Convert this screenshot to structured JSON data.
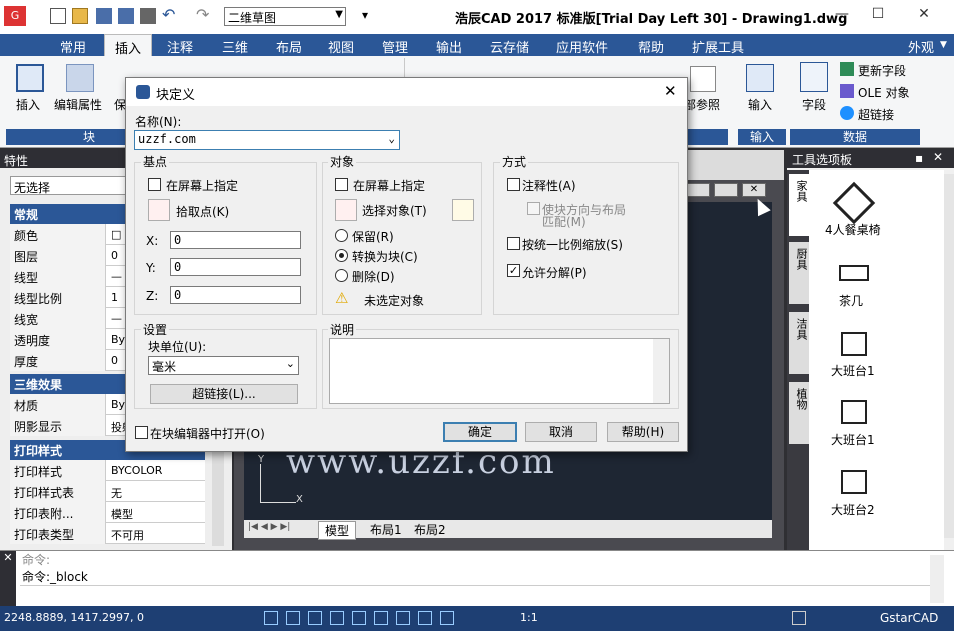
{
  "titlebar": {
    "title": "浩辰CAD 2017 标准版[Trial Day Left 30] - Drawing1.dwg",
    "workspace": "二维草图",
    "colors": {
      "accent": "#2b5797"
    }
  },
  "menu": {
    "tabs": [
      "常用",
      "插入",
      "注释",
      "三维",
      "布局",
      "视图",
      "管理",
      "输出",
      "云存储",
      "应用软件",
      "帮助",
      "扩展工具"
    ],
    "right": "外观"
  },
  "ribbon": {
    "insert_label": "插入",
    "edit_attr_label": "编辑属性",
    "bao_label": "保",
    "group_block": "块",
    "xref_label": "外部参照",
    "input_label": "输入",
    "group_input": "输入",
    "field_label": "字段",
    "update_field": "更新字段",
    "ole_object": "OLE 对象",
    "hyperlink": "超链接",
    "group_data": "数据"
  },
  "left_panel": {
    "title": "特性",
    "selection": "无选择",
    "sections": {
      "general": "常规",
      "three_d": "三维效果",
      "print": "打印样式"
    },
    "general_rows": [
      {
        "k": "颜色",
        "v": "□"
      },
      {
        "k": "图层",
        "v": "0"
      },
      {
        "k": "线型",
        "v": "—"
      },
      {
        "k": "线型比例",
        "v": "1"
      },
      {
        "k": "线宽",
        "v": "—"
      },
      {
        "k": "透明度",
        "v": "ByL"
      },
      {
        "k": "厚度",
        "v": "0"
      }
    ],
    "three_d_rows": [
      {
        "k": "材质",
        "v": "ByL"
      },
      {
        "k": "阴影显示",
        "v": "投射"
      }
    ],
    "print_rows": [
      {
        "k": "打印样式",
        "v": "BYCOLOR"
      },
      {
        "k": "打印样式表",
        "v": "无"
      },
      {
        "k": "打印表附...",
        "v": "模型"
      },
      {
        "k": "打印表类型",
        "v": "不可用"
      }
    ]
  },
  "drawing": {
    "watermark": "www.uzzf.com",
    "tabs": [
      "模型",
      "布局1",
      "布局2"
    ],
    "axis_y": "Y",
    "axis_x": "X"
  },
  "tool_palette": {
    "title": "工具选项板",
    "side_tabs": [
      "家具",
      "厨具",
      "洁具",
      "植物"
    ],
    "items": [
      "4人餐桌椅",
      "茶几",
      "大班台1",
      "大班台1",
      "大班台2"
    ]
  },
  "command": {
    "line1": "命令:",
    "line2": "命令:_block"
  },
  "status": {
    "coords": "2248.8889, 1417.2997, 0",
    "scale": "1:1",
    "brand": "GstarCAD"
  },
  "dialog": {
    "title": "块定义",
    "name_label": "名称(N):",
    "name_value": "uzzf.com",
    "base_point": {
      "title": "基点",
      "on_screen": "在屏幕上指定",
      "pick_point": "拾取点(K)",
      "x_label": "X:",
      "x_value": "0",
      "y_label": "Y:",
      "y_value": "0",
      "z_label": "Z:",
      "z_value": "0"
    },
    "objects": {
      "title": "对象",
      "on_screen": "在屏幕上指定",
      "select_objects": "选择对象(T)",
      "retain": "保留(R)",
      "convert": "转换为块(C)",
      "delete": "删除(D)",
      "warning": "未选定对象"
    },
    "behavior": {
      "title": "方式",
      "annotative": "注释性(A)",
      "match_orient_1": "使块方向与布局",
      "match_orient_2": "匹配(M)",
      "scale_uniform": "按统一比例缩放(S)",
      "allow_explode": "允许分解(P)"
    },
    "settings": {
      "title": "设置",
      "unit_label": "块单位(U):",
      "unit_value": "毫米",
      "hyperlink": "超链接(L)..."
    },
    "description": {
      "title": "说明"
    },
    "open_in_editor": "在块编辑器中打开(O)",
    "ok": "确定",
    "cancel": "取消",
    "help": "帮助(H)"
  }
}
